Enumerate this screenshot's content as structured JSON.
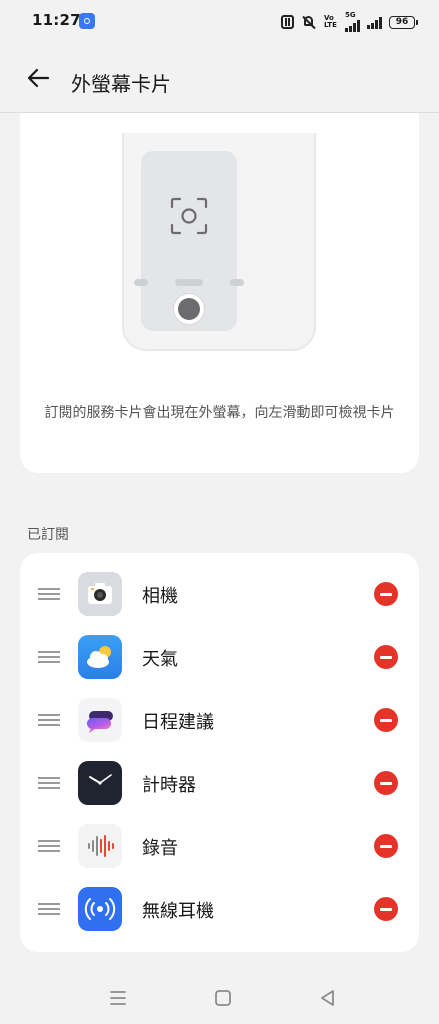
{
  "status_bar": {
    "time": "11:27",
    "network_label": "5G",
    "battery": "96",
    "volte_label": "Vo LTE"
  },
  "header": {
    "title": "外螢幕卡片"
  },
  "preview": {
    "description": "訂閱的服務卡片會出現在外螢幕，向左滑動即可檢視卡片"
  },
  "subscribed": {
    "section_title": "已訂閱",
    "items": [
      {
        "label": "相機",
        "icon": "camera-icon"
      },
      {
        "label": "天氣",
        "icon": "weather-icon"
      },
      {
        "label": "日程建議",
        "icon": "schedule-suggestion-icon"
      },
      {
        "label": "計時器",
        "icon": "clock-icon"
      },
      {
        "label": "錄音",
        "icon": "recorder-icon"
      },
      {
        "label": "無線耳機",
        "icon": "wireless-earbuds-icon"
      }
    ]
  },
  "colors": {
    "remove": "#e63329",
    "background": "#f2f2f2",
    "card": "#ffffff"
  }
}
